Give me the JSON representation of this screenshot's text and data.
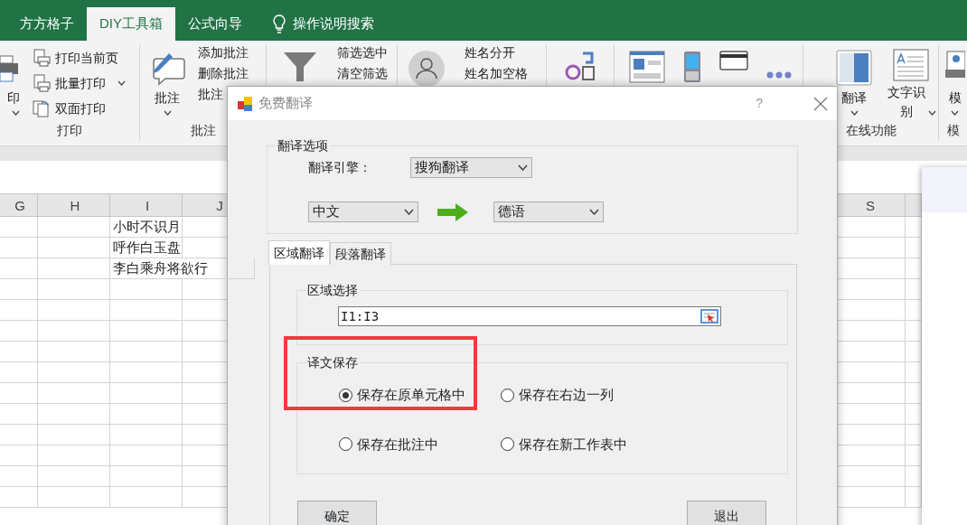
{
  "ribbon_tabs": [
    {
      "label": "方方格子",
      "selected": false,
      "kind": "tab"
    },
    {
      "label": "DIY工具箱",
      "selected": true,
      "kind": "tab"
    },
    {
      "label": "公式向导",
      "selected": false,
      "kind": "tab"
    },
    {
      "label": "操作说明搜索",
      "selected": false,
      "kind": "search"
    }
  ],
  "ribbon_groups": [
    {
      "label": "打印",
      "items": [
        {
          "kind": "large",
          "label": "印",
          "caret": true
        },
        {
          "kind": "small",
          "label": "打印当前页",
          "caret": false
        },
        {
          "kind": "small",
          "label": "批量打印",
          "caret": true
        },
        {
          "kind": "small",
          "label": "双面打印",
          "caret": false
        }
      ]
    },
    {
      "label": "批注",
      "items": [
        {
          "kind": "large",
          "label": "批注",
          "caret": true
        },
        {
          "kind": "text",
          "label": "添加批注"
        },
        {
          "kind": "text",
          "label": "删除批注"
        },
        {
          "kind": "text",
          "label": "批注"
        }
      ]
    },
    {
      "items": [
        {
          "kind": "icon"
        },
        {
          "kind": "text",
          "label": "筛选选中"
        },
        {
          "kind": "text",
          "label": "清空筛选"
        }
      ]
    },
    {
      "items": [
        {
          "kind": "icon"
        },
        {
          "kind": "text",
          "label": "姓名分开"
        },
        {
          "kind": "text",
          "label": "姓名加空格"
        }
      ]
    },
    {
      "items": [
        {
          "kind": "icon"
        }
      ]
    },
    {
      "items": [
        {
          "kind": "icon"
        },
        {
          "kind": "icon"
        },
        {
          "kind": "icon"
        },
        {
          "kind": "icon"
        }
      ]
    },
    {
      "label": "在线功能",
      "items": [
        {
          "kind": "large",
          "label": "翻译",
          "caret": true
        },
        {
          "kind": "large",
          "label": "文字识别",
          "caret": true
        }
      ]
    },
    {
      "label": "模",
      "items": [
        {
          "kind": "large",
          "label": "模",
          "caret": true
        }
      ]
    }
  ],
  "sheet": {
    "columns": [
      "G",
      "H",
      "I",
      "J",
      "S"
    ],
    "column_I_values": [
      "小时不识月",
      "呼作白玉盘",
      "李白乘舟将欲行"
    ]
  },
  "dialog": {
    "title": "免费翻译",
    "help": "?",
    "options_group": {
      "title": "翻译选项",
      "engine_label": "翻译引擎：",
      "engine": "搜狗翻译",
      "source_language": "中文",
      "target_language": "德语"
    },
    "tabs": [
      {
        "label": "区域翻译",
        "selected": true
      },
      {
        "label": "段落翻译",
        "selected": false
      }
    ],
    "range_group": {
      "title": "区域选择",
      "value": "I1:I3"
    },
    "save_group": {
      "title": "译文保存",
      "highlighted": true,
      "options": [
        {
          "label": "保存在原单元格中",
          "selected": true
        },
        {
          "label": "保存在右边一列",
          "selected": false
        },
        {
          "label": "保存在批注中",
          "selected": false
        },
        {
          "label": "保存在新工作表中",
          "selected": false
        }
      ]
    },
    "buttons": [
      "确定",
      "退出"
    ]
  }
}
